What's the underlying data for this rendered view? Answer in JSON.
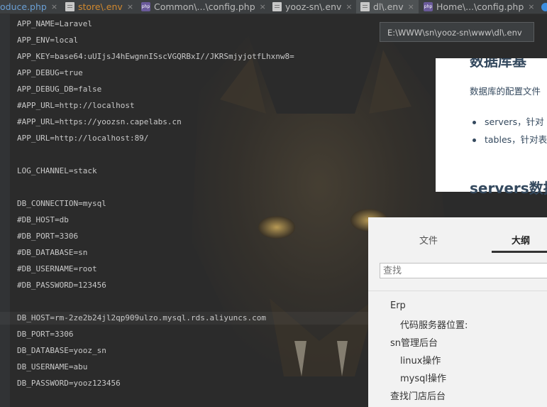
{
  "tabs": [
    {
      "label": "oduce.php",
      "close": "×"
    },
    {
      "label": "store\\.env",
      "close": "×"
    },
    {
      "label": "Common\\...\\config.php",
      "close": "×"
    },
    {
      "label": "yooz-sn\\.env",
      "close": "×"
    },
    {
      "label": "dl\\.env",
      "close": "×"
    },
    {
      "label": "Home\\...\\config.php",
      "close": "×"
    }
  ],
  "editor": {
    "lines": [
      "APP_NAME=Laravel",
      "APP_ENV=local",
      "APP_KEY=base64:uUIjsJ4hEwgnnISscVGQRBxI//JKRSmjyjotfLhxnw8=",
      "APP_DEBUG=true",
      "APP_DEBUG_DB=false",
      "#APP_URL=http://localhost",
      "#APP_URL=https://yoozsn.capelabs.cn",
      "APP_URL=http://localhost:89/",
      "",
      "LOG_CHANNEL=stack",
      "",
      "DB_CONNECTION=mysql",
      "#DB_HOST=db",
      "#DB_PORT=3306",
      "#DB_DATABASE=sn",
      "#DB_USERNAME=root",
      "#DB_PASSWORD=123456",
      "",
      "DB_HOST=rm-2ze2b24jl2qp909ulzo.mysql.rds.aliyuncs.com",
      "DB_PORT=3306",
      "DB_DATABASE=yooz_sn",
      "DB_USERNAME=abu",
      "DB_PASSWORD=yooz123456"
    ]
  },
  "tooltip": {
    "text": "E:\\WWW\\sn\\yooz-sn\\www\\dl\\.env"
  },
  "preview": {
    "heading": "数据库基",
    "text": "数据库的配置文件",
    "bullets": [
      "servers，针对",
      "tables，针对表"
    ],
    "subheading": "servers数据"
  },
  "outline": {
    "tab_file": "文件",
    "tab_outline": "大纲",
    "search_placeholder": "查找",
    "items": [
      "Erp",
      "代码服务器位置:",
      "sn管理后台",
      "linux操作",
      "mysql操作",
      "查找门店后台"
    ]
  }
}
